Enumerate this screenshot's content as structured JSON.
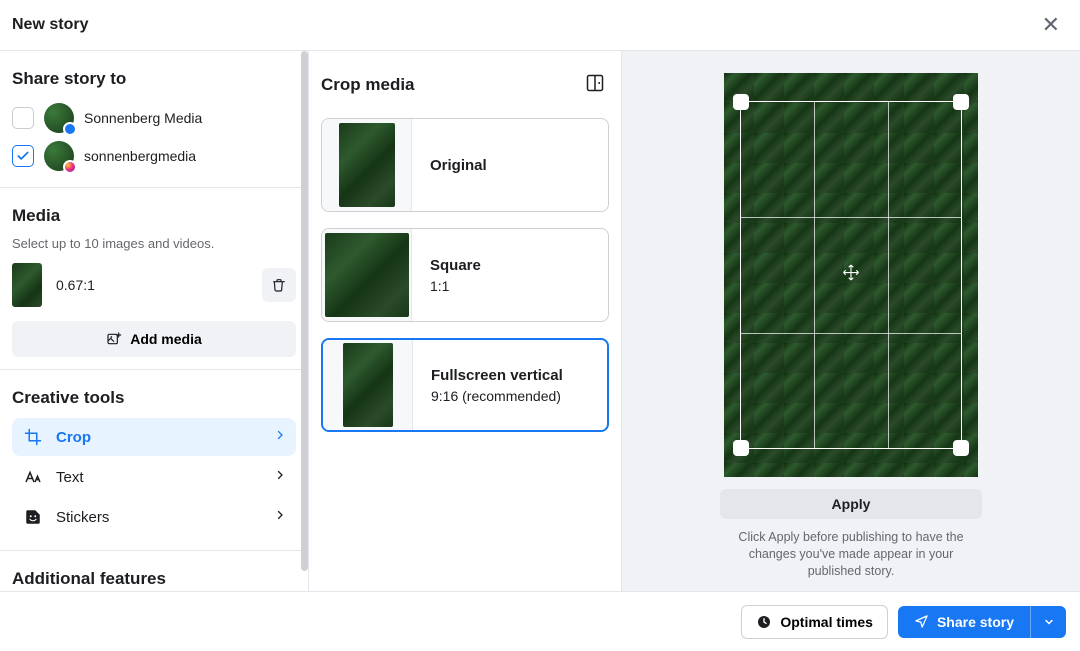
{
  "header": {
    "title": "New story"
  },
  "sidebar": {
    "share_heading": "Share story to",
    "accounts": [
      {
        "name": "Sonnenberg Media",
        "checked": false,
        "network": "fb"
      },
      {
        "name": "sonnenbergmedia",
        "checked": true,
        "network": "ig"
      }
    ],
    "media_heading": "Media",
    "media_sub": "Select up to 10 images and videos.",
    "media_items": [
      {
        "ratio_label": "0.67:1"
      }
    ],
    "add_media_label": "Add media",
    "tools_heading": "Creative tools",
    "tools": [
      {
        "key": "crop",
        "label": "Crop",
        "active": true
      },
      {
        "key": "text",
        "label": "Text",
        "active": false
      },
      {
        "key": "stickers",
        "label": "Stickers",
        "active": false
      }
    ],
    "additional_heading": "Additional features"
  },
  "crop_panel": {
    "title": "Crop media",
    "options": [
      {
        "key": "original",
        "name": "Original",
        "sub": "",
        "selected": false
      },
      {
        "key": "square",
        "name": "Square",
        "sub": "1:1",
        "selected": false
      },
      {
        "key": "fullscreen_vertical",
        "name": "Fullscreen vertical",
        "sub": "9:16 (recommended)",
        "selected": true
      }
    ]
  },
  "preview": {
    "apply_label": "Apply",
    "hint": "Click Apply before publishing to have the changes you've made appear in your published story."
  },
  "footer": {
    "optimal_label": "Optimal times",
    "share_label": "Share story"
  }
}
